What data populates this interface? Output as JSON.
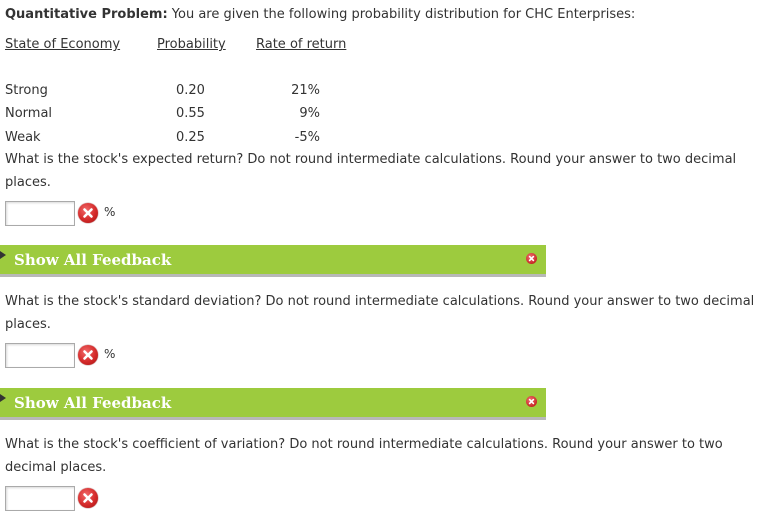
{
  "intro": {
    "label": "Quantitative Problem:",
    "text": " You are given the following probability distribution for CHC Enterprises:"
  },
  "table": {
    "headers": [
      "State of Economy",
      "Probability",
      "Rate of return"
    ],
    "rows": [
      {
        "state": "Strong",
        "probability": "0.20",
        "rate": "21%"
      },
      {
        "state": "Normal",
        "probability": "0.55",
        "rate": "9%"
      },
      {
        "state": "Weak",
        "probability": "0.25",
        "rate": "-5%"
      }
    ]
  },
  "questions": [
    {
      "text": "What is the stock's expected return? Do not round intermediate calculations. Round your answer to two decimal places.",
      "value": "",
      "unit": "%"
    },
    {
      "text": "What is the stock's standard deviation? Do not round intermediate calculations. Round your answer to two decimal places.",
      "value": "",
      "unit": "%"
    },
    {
      "text": "What is the stock's coefficient of variation? Do not round intermediate calculations. Round your answer to two decimal places.",
      "value": "",
      "unit": ""
    }
  ],
  "feedback": {
    "label": "Show All Feedback",
    "bar_color": "#9dcb3e"
  },
  "colors": {
    "error": "#d42a2a"
  },
  "icons": {
    "incorrect": "x-circle-icon",
    "toggle": "triangle-right-icon",
    "close": "close-icon"
  }
}
